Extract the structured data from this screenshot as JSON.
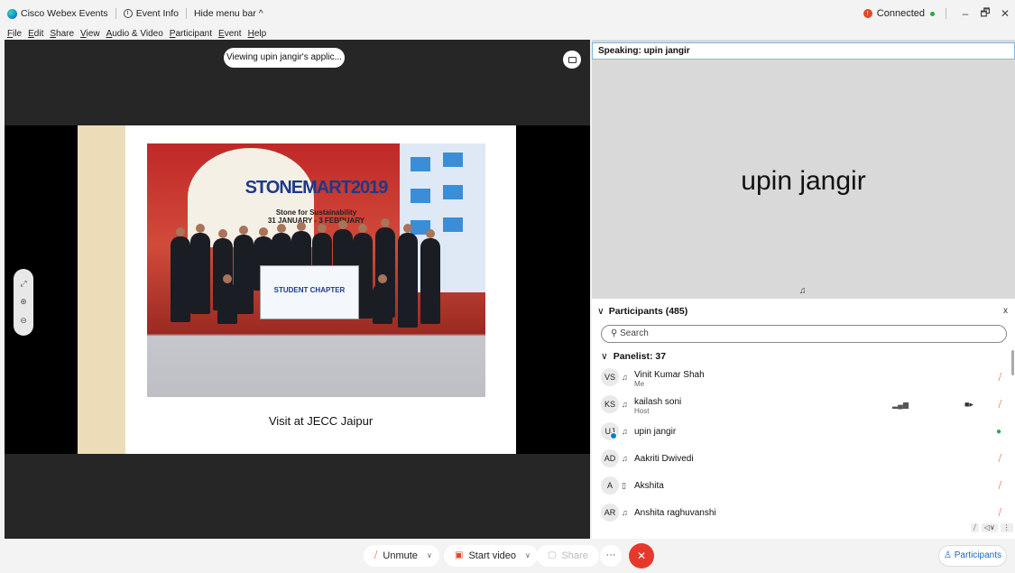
{
  "window": {
    "app_name": "Cisco Webex Events",
    "event_info": "Event Info",
    "hide_menu": "Hide menu bar ^",
    "status": "Connected",
    "minimize": "–",
    "restore": "🗗",
    "close": "✕"
  },
  "menu": [
    "File",
    "Edit",
    "Share",
    "View",
    "Audio & Video",
    "Participant",
    "Event",
    "Help"
  ],
  "stage": {
    "viewing_label": "Viewing upin jangir's applic...",
    "slide_caption": "Visit at JECC Jaipur",
    "photo_title": "STONEMART2019",
    "photo_subtitle": "Stone for Sustainability",
    "photo_dates": "31 JANUARY - 3 FEBRUARY",
    "banner_text": "STUDENT CHAPTER",
    "zoom_tools": [
      "⤢",
      "⊕",
      "⊖"
    ]
  },
  "speaker": {
    "speaking_prefix": "Speaking:",
    "speaking_name": "upin jangir",
    "display_name": "upin jangir"
  },
  "participants": {
    "header": "Participants (485)",
    "search_placeholder": "Search",
    "group": "Panelist: 37",
    "list": [
      {
        "initials": "VS",
        "name": "Vinit Kumar Shah",
        "role": "Me",
        "device": "audio",
        "mic": "muted"
      },
      {
        "initials": "KS",
        "name": "kailash soni",
        "role": "Host",
        "device": "audio",
        "mic": "muted",
        "video": true
      },
      {
        "initials": "UJ",
        "name": "upin jangir",
        "role": "",
        "device": "audio",
        "mic": "on"
      },
      {
        "initials": "AD",
        "name": "Aakriti Dwivedi",
        "role": "",
        "device": "audio",
        "mic": "muted"
      },
      {
        "initials": "A",
        "name": "Akshita",
        "role": "",
        "device": "phone",
        "mic": "muted"
      },
      {
        "initials": "AR",
        "name": "Anshita raghuvanshi",
        "role": "",
        "device": "audio",
        "mic": "muted"
      }
    ]
  },
  "controls": {
    "unmute": "Unmute",
    "start_video": "Start video",
    "share": "Share",
    "more": "···",
    "end": "✕",
    "participants": "Participants"
  },
  "colors": {
    "accent_red": "#e6392b",
    "connected_green": "#2ca84b",
    "link_blue": "#1d67b5"
  }
}
